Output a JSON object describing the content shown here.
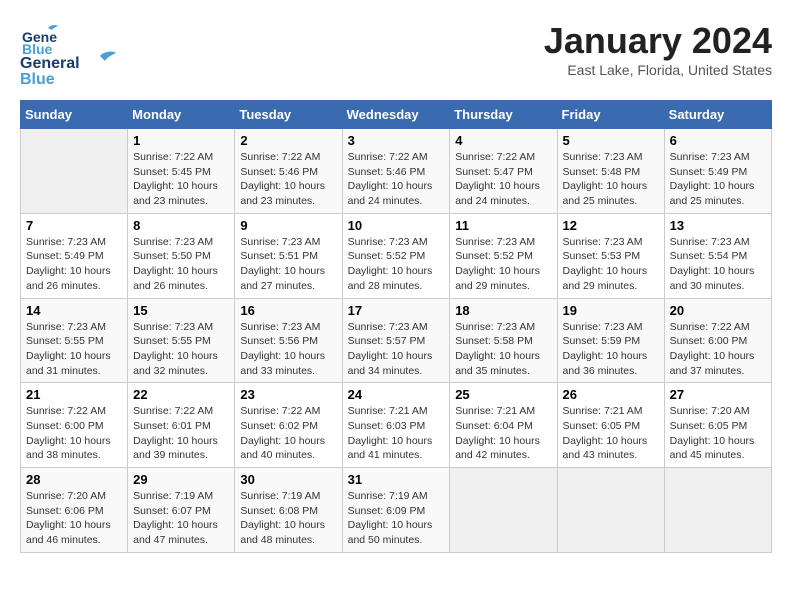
{
  "header": {
    "logo_general": "General",
    "logo_blue": "Blue",
    "title": "January 2024",
    "subtitle": "East Lake, Florida, United States"
  },
  "days_of_week": [
    "Sunday",
    "Monday",
    "Tuesday",
    "Wednesday",
    "Thursday",
    "Friday",
    "Saturday"
  ],
  "weeks": [
    [
      {
        "day": "",
        "info": ""
      },
      {
        "day": "1",
        "info": "Sunrise: 7:22 AM\nSunset: 5:45 PM\nDaylight: 10 hours\nand 23 minutes."
      },
      {
        "day": "2",
        "info": "Sunrise: 7:22 AM\nSunset: 5:46 PM\nDaylight: 10 hours\nand 23 minutes."
      },
      {
        "day": "3",
        "info": "Sunrise: 7:22 AM\nSunset: 5:46 PM\nDaylight: 10 hours\nand 24 minutes."
      },
      {
        "day": "4",
        "info": "Sunrise: 7:22 AM\nSunset: 5:47 PM\nDaylight: 10 hours\nand 24 minutes."
      },
      {
        "day": "5",
        "info": "Sunrise: 7:23 AM\nSunset: 5:48 PM\nDaylight: 10 hours\nand 25 minutes."
      },
      {
        "day": "6",
        "info": "Sunrise: 7:23 AM\nSunset: 5:49 PM\nDaylight: 10 hours\nand 25 minutes."
      }
    ],
    [
      {
        "day": "7",
        "info": "Sunrise: 7:23 AM\nSunset: 5:49 PM\nDaylight: 10 hours\nand 26 minutes."
      },
      {
        "day": "8",
        "info": "Sunrise: 7:23 AM\nSunset: 5:50 PM\nDaylight: 10 hours\nand 26 minutes."
      },
      {
        "day": "9",
        "info": "Sunrise: 7:23 AM\nSunset: 5:51 PM\nDaylight: 10 hours\nand 27 minutes."
      },
      {
        "day": "10",
        "info": "Sunrise: 7:23 AM\nSunset: 5:52 PM\nDaylight: 10 hours\nand 28 minutes."
      },
      {
        "day": "11",
        "info": "Sunrise: 7:23 AM\nSunset: 5:52 PM\nDaylight: 10 hours\nand 29 minutes."
      },
      {
        "day": "12",
        "info": "Sunrise: 7:23 AM\nSunset: 5:53 PM\nDaylight: 10 hours\nand 29 minutes."
      },
      {
        "day": "13",
        "info": "Sunrise: 7:23 AM\nSunset: 5:54 PM\nDaylight: 10 hours\nand 30 minutes."
      }
    ],
    [
      {
        "day": "14",
        "info": "Sunrise: 7:23 AM\nSunset: 5:55 PM\nDaylight: 10 hours\nand 31 minutes."
      },
      {
        "day": "15",
        "info": "Sunrise: 7:23 AM\nSunset: 5:55 PM\nDaylight: 10 hours\nand 32 minutes."
      },
      {
        "day": "16",
        "info": "Sunrise: 7:23 AM\nSunset: 5:56 PM\nDaylight: 10 hours\nand 33 minutes."
      },
      {
        "day": "17",
        "info": "Sunrise: 7:23 AM\nSunset: 5:57 PM\nDaylight: 10 hours\nand 34 minutes."
      },
      {
        "day": "18",
        "info": "Sunrise: 7:23 AM\nSunset: 5:58 PM\nDaylight: 10 hours\nand 35 minutes."
      },
      {
        "day": "19",
        "info": "Sunrise: 7:23 AM\nSunset: 5:59 PM\nDaylight: 10 hours\nand 36 minutes."
      },
      {
        "day": "20",
        "info": "Sunrise: 7:22 AM\nSunset: 6:00 PM\nDaylight: 10 hours\nand 37 minutes."
      }
    ],
    [
      {
        "day": "21",
        "info": "Sunrise: 7:22 AM\nSunset: 6:00 PM\nDaylight: 10 hours\nand 38 minutes."
      },
      {
        "day": "22",
        "info": "Sunrise: 7:22 AM\nSunset: 6:01 PM\nDaylight: 10 hours\nand 39 minutes."
      },
      {
        "day": "23",
        "info": "Sunrise: 7:22 AM\nSunset: 6:02 PM\nDaylight: 10 hours\nand 40 minutes."
      },
      {
        "day": "24",
        "info": "Sunrise: 7:21 AM\nSunset: 6:03 PM\nDaylight: 10 hours\nand 41 minutes."
      },
      {
        "day": "25",
        "info": "Sunrise: 7:21 AM\nSunset: 6:04 PM\nDaylight: 10 hours\nand 42 minutes."
      },
      {
        "day": "26",
        "info": "Sunrise: 7:21 AM\nSunset: 6:05 PM\nDaylight: 10 hours\nand 43 minutes."
      },
      {
        "day": "27",
        "info": "Sunrise: 7:20 AM\nSunset: 6:05 PM\nDaylight: 10 hours\nand 45 minutes."
      }
    ],
    [
      {
        "day": "28",
        "info": "Sunrise: 7:20 AM\nSunset: 6:06 PM\nDaylight: 10 hours\nand 46 minutes."
      },
      {
        "day": "29",
        "info": "Sunrise: 7:19 AM\nSunset: 6:07 PM\nDaylight: 10 hours\nand 47 minutes."
      },
      {
        "day": "30",
        "info": "Sunrise: 7:19 AM\nSunset: 6:08 PM\nDaylight: 10 hours\nand 48 minutes."
      },
      {
        "day": "31",
        "info": "Sunrise: 7:19 AM\nSunset: 6:09 PM\nDaylight: 10 hours\nand 50 minutes."
      },
      {
        "day": "",
        "info": ""
      },
      {
        "day": "",
        "info": ""
      },
      {
        "day": "",
        "info": ""
      }
    ]
  ]
}
